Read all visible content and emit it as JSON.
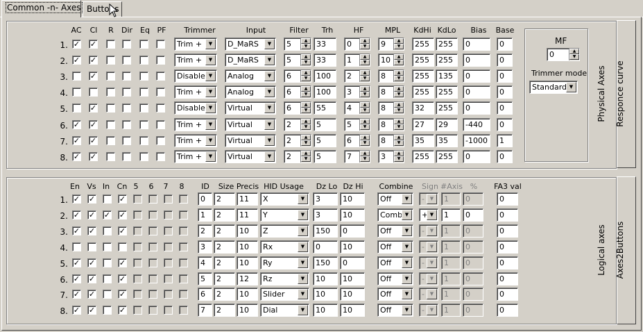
{
  "tabs": [
    "Common -n- Axes",
    "Buttons"
  ],
  "physical": {
    "headers": {
      "ac": "AC",
      "cl": "Cl",
      "r": "R",
      "dir": "Dir",
      "eq": "Eq",
      "pf": "PF",
      "trimmer": "Trimmer",
      "input": "Input",
      "filter": "Filter",
      "trh": "Trh",
      "hf": "HF",
      "mpl": "MPL",
      "kdhi": "KdHi",
      "kdlo": "KdLo",
      "bias": "Bias",
      "base": "Base"
    },
    "rows": [
      {
        "label": "1.",
        "ac": true,
        "cl": true,
        "r": false,
        "dir": false,
        "eq": false,
        "pf": false,
        "trimmer": "Trim +",
        "input": "D_MaRS",
        "filter": "5",
        "trh": "33",
        "hf": "0",
        "mpl": "9",
        "kdhi": "255",
        "kdlo": "255",
        "bias": "0",
        "base": "0"
      },
      {
        "label": "2.",
        "ac": true,
        "cl": true,
        "r": false,
        "dir": false,
        "eq": false,
        "pf": false,
        "trimmer": "Trim +",
        "input": "D_MaRS",
        "filter": "5",
        "trh": "33",
        "hf": "1",
        "mpl": "10",
        "kdhi": "255",
        "kdlo": "255",
        "bias": "0",
        "base": "0"
      },
      {
        "label": "3.",
        "ac": false,
        "cl": true,
        "r": false,
        "dir": false,
        "eq": false,
        "pf": false,
        "trimmer": "Disable",
        "input": "Analog",
        "filter": "6",
        "trh": "100",
        "hf": "2",
        "mpl": "8",
        "kdhi": "255",
        "kdlo": "135",
        "bias": "0",
        "base": "0"
      },
      {
        "label": "4.",
        "ac": false,
        "cl": false,
        "r": false,
        "dir": false,
        "eq": false,
        "pf": false,
        "trimmer": "Trim +",
        "input": "Analog",
        "filter": "6",
        "trh": "100",
        "hf": "3",
        "mpl": "8",
        "kdhi": "255",
        "kdlo": "255",
        "bias": "0",
        "base": "0"
      },
      {
        "label": "5.",
        "ac": false,
        "cl": true,
        "r": false,
        "dir": false,
        "eq": false,
        "pf": false,
        "trimmer": "Disable",
        "input": "Virtual",
        "filter": "6",
        "trh": "55",
        "hf": "4",
        "mpl": "8",
        "kdhi": "32",
        "kdlo": "255",
        "bias": "0",
        "base": "0"
      },
      {
        "label": "6.",
        "ac": true,
        "cl": true,
        "r": false,
        "dir": false,
        "eq": false,
        "pf": false,
        "trimmer": "Trim +",
        "input": "Virtual",
        "filter": "2",
        "trh": "5",
        "hf": "5",
        "mpl": "8",
        "kdhi": "27",
        "kdlo": "29",
        "bias": "-440",
        "base": "0"
      },
      {
        "label": "7.",
        "ac": true,
        "cl": true,
        "r": false,
        "dir": false,
        "eq": false,
        "pf": false,
        "trimmer": "Trim +",
        "input": "Virtual",
        "filter": "2",
        "trh": "5",
        "hf": "6",
        "mpl": "8",
        "kdhi": "35",
        "kdlo": "35",
        "bias": "-1000",
        "base": "1"
      },
      {
        "label": "8.",
        "ac": true,
        "cl": true,
        "r": false,
        "dir": false,
        "eq": false,
        "pf": false,
        "trimmer": "Trim +",
        "input": "Virtual",
        "filter": "2",
        "trh": "5",
        "hf": "7",
        "mpl": "3",
        "kdhi": "255",
        "kdlo": "255",
        "bias": "0",
        "base": "0"
      }
    ],
    "mf_label": "MF",
    "mf_value": "0",
    "trimmer_mode_label": "Trimmer mode",
    "trimmer_mode_value": "Standard",
    "side_label": "Physical Axes",
    "side_button": "Responce curve"
  },
  "logical": {
    "headers": {
      "en": "En",
      "vs": "Vs",
      "in": "In",
      "cn": "Cn",
      "c5": "5",
      "c6": "6",
      "c7": "7",
      "c8": "8",
      "id": "ID",
      "size": "Size",
      "precis": "Precis",
      "hid": "HID Usage",
      "dzlo": "Dz Lo",
      "dzhi": "Dz Hi",
      "combine": "Combine",
      "sign": "Sign",
      "naxis": "#Axis",
      "pct": "%",
      "fa3": "FA3 val"
    },
    "rows": [
      {
        "label": "1.",
        "en": true,
        "vs": true,
        "in": false,
        "cn": true,
        "id": "0",
        "size": "2",
        "precis": "11",
        "hid": "X",
        "dzlo": "3",
        "dzhi": "10",
        "combine": "Off",
        "sign": "-",
        "naxis": "1",
        "pct": "0",
        "fa3": "0",
        "comb_active": false
      },
      {
        "label": "2.",
        "en": true,
        "vs": true,
        "in": true,
        "cn": true,
        "id": "1",
        "size": "2",
        "precis": "11",
        "hid": "Y",
        "dzlo": "3",
        "dzhi": "10",
        "combine": "Combi",
        "sign": "+",
        "naxis": "1",
        "pct": "0",
        "fa3": "0",
        "comb_active": true
      },
      {
        "label": "3.",
        "en": true,
        "vs": true,
        "in": false,
        "cn": true,
        "id": "2",
        "size": "2",
        "precis": "10",
        "hid": "Z",
        "dzlo": "150",
        "dzhi": "0",
        "combine": "Off",
        "sign": "-",
        "naxis": "1",
        "pct": "0",
        "fa3": "0",
        "comb_active": false
      },
      {
        "label": "4.",
        "en": false,
        "vs": false,
        "in": false,
        "cn": false,
        "id": "3",
        "size": "2",
        "precis": "10",
        "hid": "Rx",
        "dzlo": "0",
        "dzhi": "10",
        "combine": "Off",
        "sign": "-",
        "naxis": "1",
        "pct": "0",
        "fa3": "0",
        "comb_active": false
      },
      {
        "label": "5.",
        "en": true,
        "vs": true,
        "in": false,
        "cn": true,
        "id": "4",
        "size": "2",
        "precis": "10",
        "hid": "Ry",
        "dzlo": "150",
        "dzhi": "0",
        "combine": "Off",
        "sign": "-",
        "naxis": "1",
        "pct": "0",
        "fa3": "0",
        "comb_active": false
      },
      {
        "label": "6.",
        "en": true,
        "vs": true,
        "in": false,
        "cn": true,
        "id": "5",
        "size": "2",
        "precis": "12",
        "hid": "Rz",
        "dzlo": "10",
        "dzhi": "10",
        "combine": "Off",
        "sign": "-",
        "naxis": "1",
        "pct": "0",
        "fa3": "0",
        "comb_active": false
      },
      {
        "label": "7.",
        "en": true,
        "vs": true,
        "in": false,
        "cn": true,
        "id": "6",
        "size": "2",
        "precis": "10",
        "hid": "Slider",
        "dzlo": "10",
        "dzhi": "10",
        "combine": "Off",
        "sign": "-",
        "naxis": "1",
        "pct": "0",
        "fa3": "0",
        "comb_active": false
      },
      {
        "label": "8.",
        "en": true,
        "vs": true,
        "in": false,
        "cn": true,
        "id": "7",
        "size": "2",
        "precis": "10",
        "hid": "Dial",
        "dzlo": "10",
        "dzhi": "10",
        "combine": "Off",
        "sign": "-",
        "naxis": "1",
        "pct": "0",
        "fa3": "0",
        "comb_active": false
      }
    ],
    "side_label": "Logical axes",
    "side_button": "Axes2Buttons"
  },
  "icons": {
    "dropdown": "chevron-down-icon",
    "spin_up": "spin-up-icon",
    "spin_down": "spin-down-icon",
    "cursor": "mouse-pointer-icon"
  }
}
